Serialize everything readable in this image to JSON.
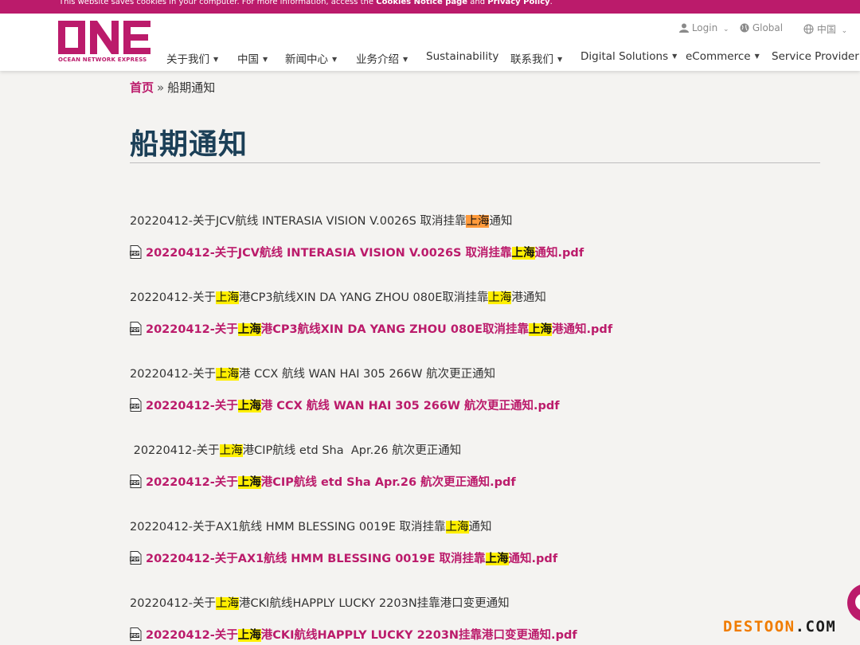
{
  "cookie_bar": {
    "text_start": "This website saves cookies in your computer. For more information, access the ",
    "link1": "Cookies Notice page",
    "and": " and ",
    "link2": "Privacy Policy",
    "end": "."
  },
  "brand": {
    "logo": "ONE",
    "tagline": "OCEAN NETWORK EXPRESS",
    "color": "#bb1b6b"
  },
  "utility": {
    "login": "Login",
    "global": "Global",
    "region": "中国"
  },
  "nav": [
    {
      "label": "关于我们",
      "caret": "▼"
    },
    {
      "label": "中国",
      "caret": "▼"
    },
    {
      "label": "新闻中心",
      "caret": "▼"
    },
    {
      "label": "业务介绍",
      "caret": "▼"
    },
    {
      "label": "Sustainability"
    },
    {
      "label": "联系我们",
      "caret": "▼"
    },
    {
      "label": "Digital Solutions",
      "caret": "▼"
    },
    {
      "label": "eCommerce",
      "caret": "▼"
    },
    {
      "label": "Service Provider L"
    }
  ],
  "breadcrumb": {
    "home": "首页",
    "sep": "»",
    "current": "船期通知"
  },
  "page_title": "船期通知",
  "notices": [
    {
      "title": {
        "pre": "20220412-关于JCV航线 INTERASIA VISION V.0026S 取消挂靠",
        "hl": "上海",
        "post": "通知"
      },
      "link": {
        "pre": "20220412-关于JCV航线 INTERASIA VISION V.0026S 取消挂靠",
        "hl": "上海",
        "post": "通知.pdf"
      }
    },
    {
      "title": {
        "pre": "20220412-关于",
        "hl": "上海",
        "mid": "港CP3航线XIN DA YANG ZHOU 080E取消挂靠",
        "hl2": "上海",
        "post": "港通知"
      },
      "link": {
        "pre": "20220412-关于",
        "hl": "上海",
        "mid": "港CP3航线XIN DA YANG ZHOU 080E取消挂靠",
        "hl2": "上海",
        "post": "港通知.pdf"
      }
    },
    {
      "title": {
        "pre": "20220412-关于",
        "hl": "上海",
        "post": "港 CCX 航线 WAN HAI 305 266W 航次更正通知"
      },
      "link": {
        "pre": "20220412-关于",
        "hl": "上海",
        "post": "港 CCX 航线 WAN HAI 305 266W 航次更正通知.pdf"
      }
    },
    {
      "title": {
        "pre": " 20220412-关于",
        "hl": "上海",
        "post": "港CIP航线 etd Sha  Apr.26 航次更正通知"
      },
      "link": {
        "pre": "20220412-关于",
        "hl": "上海",
        "post": "港CIP航线 etd Sha Apr.26 航次更正通知.pdf"
      }
    },
    {
      "title": {
        "pre": "20220412-关于AX1航线 HMM BLESSING 0019E 取消挂靠",
        "hl": "上海",
        "post": "通知"
      },
      "link": {
        "pre": "20220412-关于AX1航线 HMM BLESSING 0019E 取消挂靠",
        "hl": "上海",
        "post": "通知.pdf"
      }
    },
    {
      "title": {
        "pre": "20220412-关于",
        "hl": "上海",
        "post": "港CKI航线HAPPLY LUCKY 2203N挂靠港口变更通知"
      },
      "link": {
        "pre": "20220412-关于",
        "hl": "上海",
        "post": "港CKI航线HAPPLY LUCKY 2203N挂靠港口变更通知.pdf"
      }
    }
  ],
  "watermark": {
    "part1": "DESTOON",
    "part2": ".COM"
  }
}
